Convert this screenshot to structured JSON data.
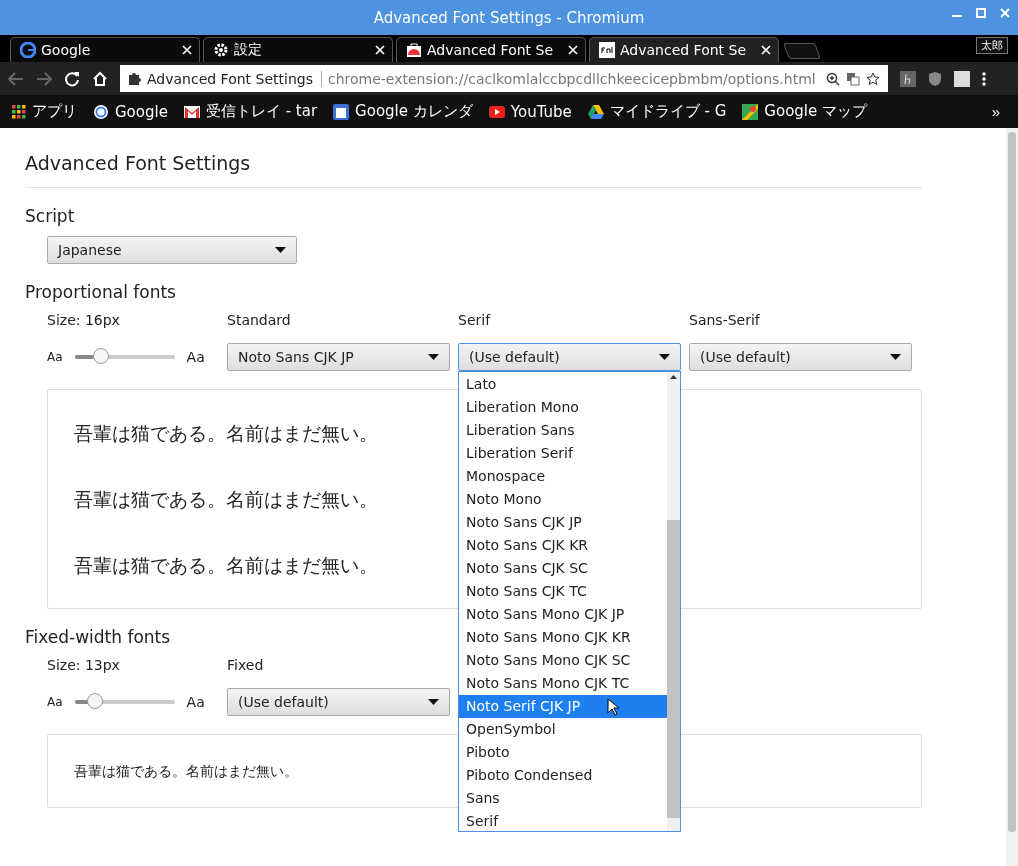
{
  "window": {
    "title": "Advanced Font Settings - Chromium"
  },
  "tabs": [
    {
      "label": "Google",
      "selected": false
    },
    {
      "label": "設定",
      "selected": false
    },
    {
      "label": "Advanced Font Se",
      "selected": false
    },
    {
      "label": "Advanced Font Se",
      "selected": true
    }
  ],
  "profile": "太郎",
  "omnibox": {
    "site": "Advanced Font Settings",
    "url": "chrome-extension://caclkomlalccbpcdllchkeecicepbmbm/options.html"
  },
  "bookmarks": [
    "アプリ",
    "Google",
    "受信トレイ - tar",
    "Google カレンダ",
    "YouTube",
    "マイドライブ - G",
    "Google マップ"
  ],
  "bookmarks_overflow": "»",
  "page": {
    "title": "Advanced Font Settings",
    "script": {
      "heading": "Script",
      "value": "Japanese"
    },
    "proportional": {
      "heading": "Proportional fonts",
      "size_label": "Size: 16px",
      "level": 0.26,
      "small": "Aa",
      "large": "Aa",
      "columns": [
        {
          "label": "Standard",
          "value": "Noto Sans CJK JP",
          "open": false
        },
        {
          "label": "Serif",
          "value": "(Use default)",
          "open": true
        },
        {
          "label": "Sans-Serif",
          "value": "(Use default)",
          "open": false
        }
      ],
      "preview": [
        "吾輩は猫である。名前はまだ無い。",
        "吾輩は猫である。名前はまだ無い。",
        "吾輩は猫である。名前はまだ無い。"
      ]
    },
    "fixed": {
      "heading": "Fixed-width fonts",
      "size_label": "Size: 13px",
      "level": 0.2,
      "small": "Aa",
      "large": "Aa",
      "columns": [
        {
          "label": "Fixed",
          "value": "(Use default)",
          "open": false
        }
      ],
      "preview": [
        "吾輩は猫である。名前はまだ無い。"
      ]
    },
    "dropdown": [
      {
        "label": "Lato",
        "selected": false
      },
      {
        "label": "Liberation Mono",
        "selected": false
      },
      {
        "label": "Liberation Sans",
        "selected": false
      },
      {
        "label": "Liberation Serif",
        "selected": false
      },
      {
        "label": "Monospace",
        "selected": false
      },
      {
        "label": "Noto Mono",
        "selected": false
      },
      {
        "label": "Noto Sans CJK JP",
        "selected": false
      },
      {
        "label": "Noto Sans CJK KR",
        "selected": false
      },
      {
        "label": "Noto Sans CJK SC",
        "selected": false
      },
      {
        "label": "Noto Sans CJK TC",
        "selected": false
      },
      {
        "label": "Noto Sans Mono CJK JP",
        "selected": false
      },
      {
        "label": "Noto Sans Mono CJK KR",
        "selected": false
      },
      {
        "label": "Noto Sans Mono CJK SC",
        "selected": false
      },
      {
        "label": "Noto Sans Mono CJK TC",
        "selected": false
      },
      {
        "label": "Noto Serif CJK JP",
        "selected": true
      },
      {
        "label": "OpenSymbol",
        "selected": false
      },
      {
        "label": "Piboto",
        "selected": false
      },
      {
        "label": "Piboto Condensed",
        "selected": false
      },
      {
        "label": "Sans",
        "selected": false
      },
      {
        "label": "Serif",
        "selected": false
      }
    ]
  }
}
